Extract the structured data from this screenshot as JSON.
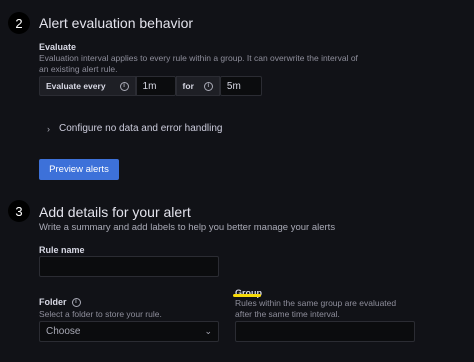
{
  "section2": {
    "number": "2",
    "title": "Alert evaluation behavior",
    "evaluate_label": "Evaluate",
    "evaluate_desc": "Evaluation interval applies to every rule within a group. It can overwrite the interval of an existing alert rule.",
    "evaluate_every_label": "Evaluate every",
    "evaluate_every_value": "1m",
    "for_label": "for",
    "for_value": "5m",
    "configure_label": "Configure no data and error handling",
    "preview_button": "Preview alerts"
  },
  "section3": {
    "number": "3",
    "title": "Add details for your alert",
    "subtitle": "Write a summary and add labels to help you better manage your alerts",
    "rule_name_label": "Rule name",
    "rule_name_value": "",
    "folder_label": "Folder",
    "folder_desc": "Select a folder to store your rule.",
    "folder_placeholder": "Choose",
    "group_label": "Group",
    "group_desc": "Rules within the same group are evaluated after the same time interval.",
    "group_value": ""
  },
  "colors": {
    "background": "#111217",
    "primary": "#3d71d9",
    "highlight": "#f5d90a"
  }
}
